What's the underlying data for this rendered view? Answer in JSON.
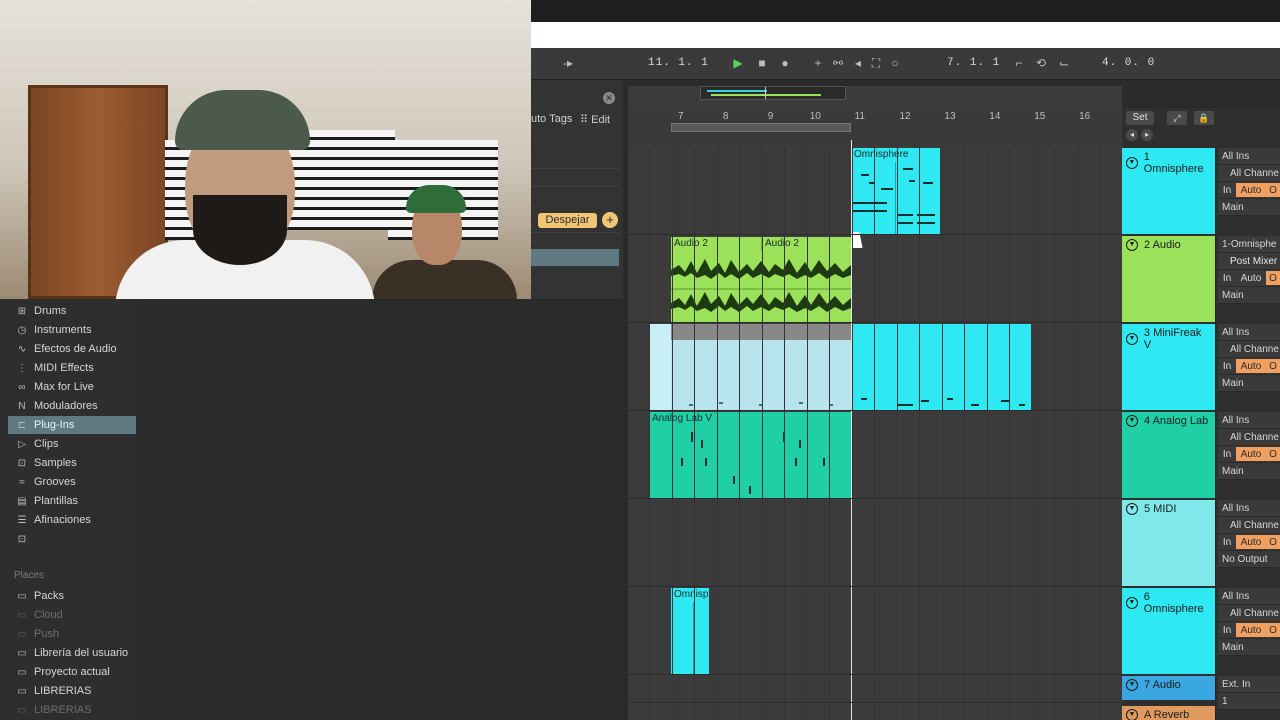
{
  "transport": {
    "arrangement_position": "11.  1.  1",
    "loop_start": "7.  1.  1",
    "loop_length": "4.  0.  0"
  },
  "browser": {
    "categories": [
      {
        "label": "Drums",
        "icon": "grid-icon"
      },
      {
        "label": "Instruments",
        "icon": "clock-icon"
      },
      {
        "label": "Efectos de Audio",
        "icon": "waveform-icon"
      },
      {
        "label": "MIDI Effects",
        "icon": "midi-icon"
      },
      {
        "label": "Max for Live",
        "icon": "max-icon"
      },
      {
        "label": "Moduladores",
        "icon": "modulator-icon"
      },
      {
        "label": "Plug-Ins",
        "icon": "plugin-icon"
      },
      {
        "label": "Clips",
        "icon": "clip-icon"
      },
      {
        "label": "Samples",
        "icon": "samples-icon"
      },
      {
        "label": "Grooves",
        "icon": "groove-icon"
      },
      {
        "label": "Plantillas",
        "icon": "template-icon"
      },
      {
        "label": "Afinaciones",
        "icon": "tuning-icon"
      }
    ],
    "selected": "Plug-Ins",
    "places_heading": "Places",
    "places": [
      {
        "label": "Packs",
        "dim": false
      },
      {
        "label": "Cloud",
        "dim": true
      },
      {
        "label": "Push",
        "dim": true
      },
      {
        "label": "Librería del usuario",
        "dim": false
      },
      {
        "label": "Proyecto actual",
        "dim": false
      },
      {
        "label": "LIBRERIAS",
        "dim": false
      },
      {
        "label": "LIBRERIAS",
        "dim": true
      }
    ]
  },
  "tags": {
    "auto_tags": "uto Tags",
    "edit": "Edit",
    "clear": "Despejar",
    "add": "+"
  },
  "ruler": {
    "bars": [
      "7",
      "8",
      "9",
      "10",
      "11",
      "12",
      "13",
      "14",
      "15",
      "16"
    ]
  },
  "clips": {
    "omnisphere_1": "Omnisphere",
    "audio_a": "Audio 2",
    "audio_b": "Audio 2",
    "analog_lab": "Analog Lab V",
    "omnisphere_6": "Omnisp"
  },
  "mixer": {
    "set": "Set",
    "tracks": [
      {
        "name": "1 Omnisphere",
        "color": "#2ee8f2",
        "io": [
          "All Ins",
          "All Channe",
          "AUTO",
          "Main"
        ]
      },
      {
        "name": "2 Audio",
        "color": "#9be25a",
        "io": [
          "1-Omnisphe",
          "Post Mixer",
          "AUTO_OFF",
          "Main"
        ]
      },
      {
        "name": "3 MiniFreak V",
        "color": "#2ee8f2",
        "io": [
          "All Ins",
          "All Channe",
          "AUTO",
          "Main"
        ]
      },
      {
        "name": "4 Analog Lab",
        "color": "#1fcfa6",
        "io": [
          "All Ins",
          "All Channe",
          "AUTO",
          "Main"
        ]
      },
      {
        "name": "5 MIDI",
        "color": "#7fe8ea",
        "io": [
          "All Ins",
          "All Channe",
          "AUTO",
          "No Output"
        ]
      },
      {
        "name": "6 Omnisphere",
        "color": "#2ee8f2",
        "io": [
          "All Ins",
          "All Channe",
          "AUTO",
          "Main"
        ]
      },
      {
        "name": "7 Audio",
        "color": "#3aa7e0",
        "io": [
          "Ext. In",
          "1"
        ]
      },
      {
        "name": "A Reverb",
        "color": "#e09a60",
        "io": []
      }
    ],
    "in_label": "In",
    "auto_label": "Auto",
    "o_label": "O"
  }
}
